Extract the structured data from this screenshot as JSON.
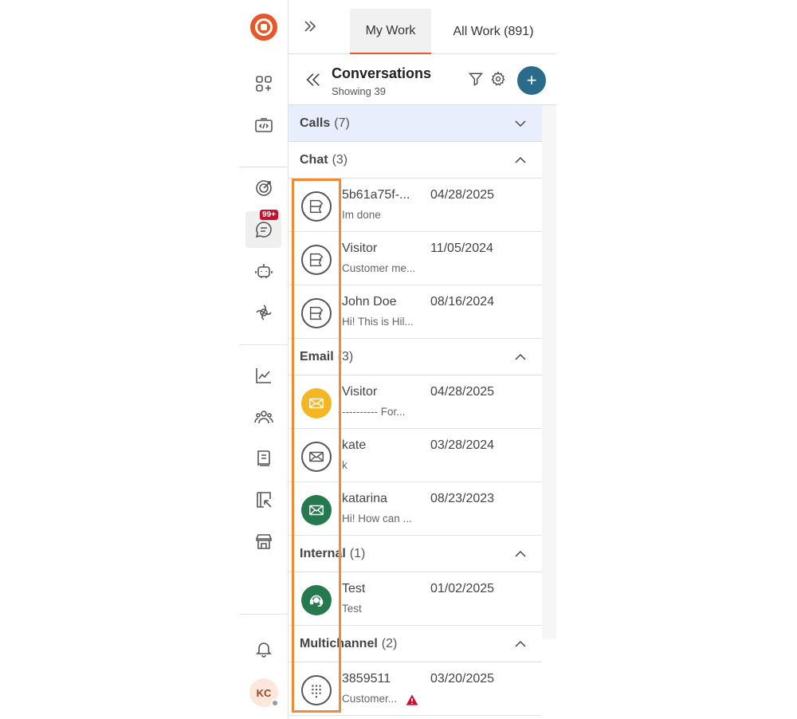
{
  "topbar": {
    "tabs": [
      {
        "label": "My Work",
        "active": true
      },
      {
        "label": "All Work (891)",
        "active": false
      }
    ]
  },
  "rail": {
    "badge": "99+",
    "avatar_initials": "KC",
    "icons": [
      "apps-icon",
      "code-icon",
      "target-icon",
      "chat-icon",
      "bot-icon",
      "ai-icon",
      "analytics-icon",
      "team-icon",
      "knowledge-icon",
      "routing-icon",
      "store-icon",
      "bell-icon"
    ]
  },
  "conversations": {
    "title": "Conversations",
    "subtitle": "Showing 39",
    "add_label": "+"
  },
  "sections": {
    "calls": {
      "name": "Calls",
      "count": "(7)"
    },
    "chat": {
      "name": "Chat",
      "count": "(3)"
    },
    "email": {
      "name": "Email",
      "count": "(3)"
    },
    "internal": {
      "name": "Internal",
      "count": "(1)"
    },
    "multichannel": {
      "name": "Multichannel",
      "count": "(2)"
    }
  },
  "items": {
    "chat": [
      {
        "name": "5b61a75f-...",
        "date": "04/28/2025",
        "preview": "Im done",
        "icon": "chat-bubble-icon"
      },
      {
        "name": "Visitor",
        "date": "11/05/2024",
        "preview": "Customer me...",
        "icon": "chat-bubble-icon"
      },
      {
        "name": "John Doe",
        "date": "08/16/2024",
        "preview": "Hi! This is Hil...",
        "icon": "chat-bubble-icon"
      }
    ],
    "email": [
      {
        "name": "Visitor",
        "date": "04/28/2025",
        "preview": "---------- For...",
        "icon": "envelope-icon",
        "color": "#f5b623"
      },
      {
        "name": "kate",
        "date": "03/28/2024",
        "preview": "k",
        "icon": "envelope-icon"
      },
      {
        "name": "katarina",
        "date": "08/23/2023",
        "preview": "Hi! How can ...",
        "icon": "envelope-icon",
        "color": "#247a4e"
      }
    ],
    "internal": [
      {
        "name": "Test",
        "date": "01/02/2025",
        "preview": "Test",
        "icon": "headset-icon",
        "color": "#247a4e"
      }
    ],
    "multichannel": [
      {
        "name": "3859511",
        "date": "03/20/2025",
        "preview": "Customer...",
        "icon": "dialpad-icon"
      }
    ]
  },
  "colors": {
    "accent": "#e8572a",
    "add_button": "#2a6b8c",
    "highlight": "#f28a34",
    "badge": "#c8102e",
    "calls_bg": "#e8eefb"
  }
}
